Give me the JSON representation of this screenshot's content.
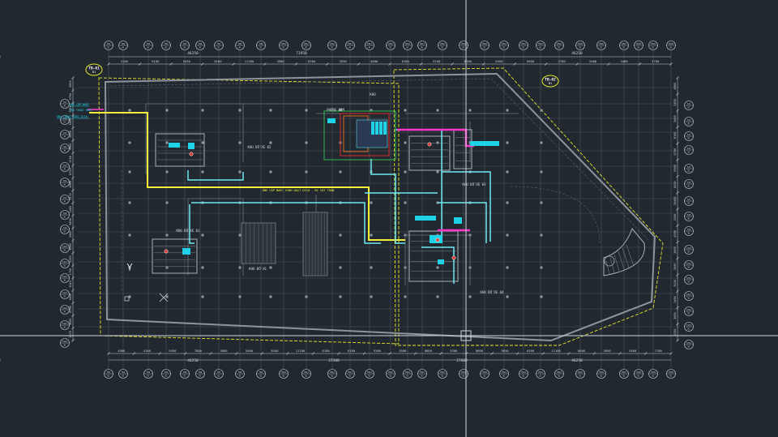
{
  "viewport": {
    "background": "#212830",
    "crosshair_color": "#cfd6dc"
  },
  "colors": {
    "grid": "#4c5560",
    "grid_bubble": "#c9ced3",
    "wall": "#8d949b",
    "structure": "#aab0b6",
    "zone_boundary": "#e6e62a",
    "main_pipe": "#f2ee3a",
    "duct": "#6ee7f0",
    "cyan_accent": "#1fd2e6",
    "magenta": "#ff35c8",
    "orange_room": "#e06a1a",
    "red_room": "#e02a2a",
    "green_room": "#2fb84a",
    "badge_text": "#ffffff"
  },
  "top_overall_dims": [
    "46250",
    "71950",
    "46250"
  ],
  "top_dims": [
    "4100",
    "6100",
    "9450",
    "8100",
    "11100",
    "3900",
    "8200",
    "3950",
    "4600",
    "6100",
    "6100",
    "8100",
    "8450",
    "9600",
    "3700",
    "5400",
    "5400",
    "3700"
  ],
  "bottom_overall_dims": [
    "46250",
    "27300",
    "27800",
    "46250"
  ],
  "bottom_dims": [
    "4900",
    "4100",
    "9450",
    "7800",
    "3600",
    "5400",
    "6100",
    "11100",
    "8100",
    "6100",
    "9100",
    "3500",
    "6600",
    "9200",
    "8600",
    "3650",
    "6200",
    "11100",
    "8600",
    "3650",
    "5400",
    "7700"
  ],
  "left_dims": [
    "2000",
    "3700",
    "7700",
    "5000",
    "2400",
    "3900",
    "5700",
    "8750",
    "8900",
    "1270",
    "1680",
    "5860",
    "3400",
    "4000",
    "5290",
    "1750",
    "3240",
    "8050",
    "8700",
    "3000",
    "1870"
  ],
  "right_dims": [
    "4800",
    "2450",
    "3400",
    "8100",
    "8700",
    "6000",
    "6030",
    "36400",
    "3100",
    "4500",
    "3600",
    "3600",
    "8150",
    "3400",
    "3000",
    "4150"
  ],
  "top_axis_labels": [
    "TB1",
    "TB2",
    "TB3",
    "TB4",
    "TB5",
    "TB6",
    "TB7",
    "TB8",
    "TB9",
    "TB10",
    "TB11",
    "TB12",
    "TB13",
    "TB14",
    "TB15",
    "TB16",
    "TB17",
    "TB18",
    "TB19",
    "TB20",
    "TB21",
    "TB22",
    "TB23",
    "TB24",
    "TB25",
    "TB26",
    "TB27",
    "TB28",
    "TB29",
    "TB30"
  ],
  "bottom_axis_labels": [
    "TB1",
    "TB2",
    "TB3",
    "TB4",
    "TB5",
    "TB6",
    "TB7",
    "TB8",
    "TB9",
    "TB10",
    "TB11",
    "TB12",
    "TB13",
    "TB14",
    "TB15",
    "TB16",
    "TB17",
    "TB18",
    "TB19",
    "TB20",
    "TB21",
    "TB22",
    "TB23",
    "TB24",
    "TB25",
    "TB26",
    "TB27",
    "TB28",
    "TB29",
    "TB30"
  ],
  "left_axis_labels": [
    "TA1",
    "TA2",
    "TA3",
    "TA4",
    "TA5",
    "TA6",
    "TA7",
    "TA8",
    "TA9",
    "TA10",
    "TA11",
    "TA12",
    "TA13",
    "TA14",
    "TA15",
    "TA16"
  ],
  "right_axis_labels": [
    "TA1",
    "TA2",
    "TA3",
    "TA4",
    "TA5",
    "TA6",
    "TA7",
    "TA8",
    "TA9",
    "TA10",
    "TA11",
    "TA12",
    "TA13",
    "TA14",
    "TA15",
    "TA16"
  ],
  "zone_badges": [
    {
      "code": "TB-01",
      "sub": "B1"
    },
    {
      "code": "TB-02",
      "sub": "B1"
    }
  ],
  "room_labels": [
    "KHU ĐỖ XE 02",
    "KHU ĐỖ XE 03",
    "PHÒNG BƠM",
    "KHU ĐỖ XE",
    "KHU ĐỖ XE 01",
    "KHO",
    "KHU ĐỖ XE 04"
  ],
  "pipe_note": "ỐNG CẤP NƯỚC SINH HOẠT D110 - ĐI SÁT TRẦN",
  "left_notes": [
    "ỐNG CẤP NƯỚC",
    "ỐNG THOÁT NƯỚC",
    "ỐNG THOÁT NƯỚC D110"
  ],
  "north_symbol": "Y"
}
